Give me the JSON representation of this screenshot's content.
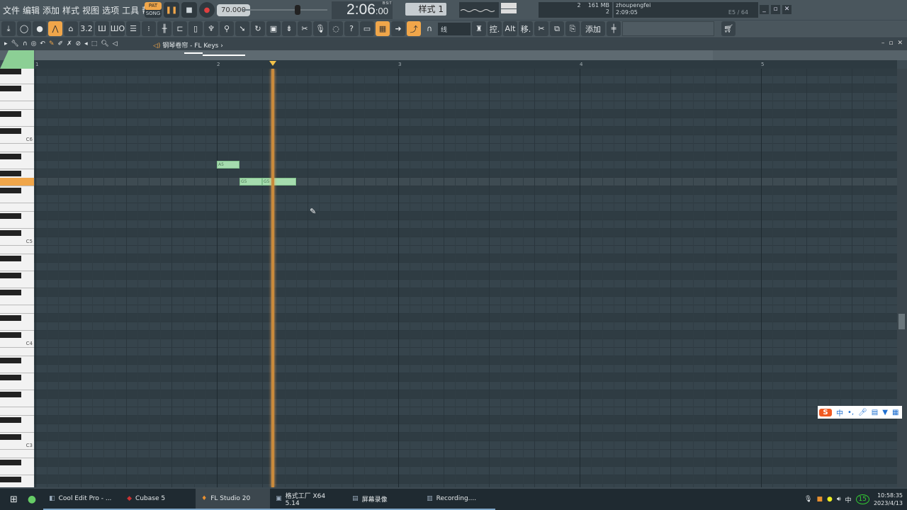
{
  "menu": [
    "文件",
    "编辑",
    "添加",
    "样式",
    "视图",
    "选项",
    "工具",
    "帮助"
  ],
  "transport": {
    "pat": "PAT",
    "song": "SONG",
    "tempo": "70.000",
    "time_main": "2:06",
    "time_small": ":00",
    "time_label": "B:S:T",
    "pattern": "样式 1"
  },
  "perf": {
    "cpu": "2",
    "mem": "161 MB",
    "poly": "2"
  },
  "hint": {
    "user": "zhoupengfei",
    "time": "2:09:05",
    "voices": "E5 / 64"
  },
  "toolbar": {
    "icons": [
      "download-icon",
      "metronome-knob-icon",
      "pitch-knob-icon",
      "typing-keyboard-icon",
      "wait-record-icon",
      "countdown-icon",
      "step-edit-icon",
      "blend-icon",
      "playlist-icon",
      "channel-rack-icon",
      "mixer-icon",
      "browser-icon",
      "project-icon",
      "plugin-picker-icon",
      "tempo-tapper-icon",
      "touch-controller-icon",
      "undo-icon",
      "save-icon",
      "render-icon",
      "cut-icon",
      "microphone-icon",
      "chat-icon",
      "help-icon",
      "view-icon",
      "piano-roll-icon",
      "arrow-icon",
      "link-icon",
      "snap-magnet-icon"
    ],
    "snap": "线",
    "add": "添加",
    "control": "控.",
    "alt": "Alt",
    "move": "移."
  },
  "pianoroll": {
    "title": "钢琴卷帘 - FL Keys",
    "bars": [
      "1",
      "2",
      "3",
      "4",
      "5"
    ],
    "key_labels": [
      "C6",
      "C5",
      "C4",
      "C3"
    ],
    "notes": [
      {
        "label": "A5",
        "pitch": "A5",
        "start": 2.0,
        "length": 0.125
      },
      {
        "label": "G5",
        "pitch": "G5",
        "start": 2.125,
        "length": 0.125
      },
      {
        "label": "G5",
        "pitch": "G5",
        "start": 2.25,
        "length": 0.1875
      }
    ],
    "playhead_bar": 2.3,
    "highlight_key": "G5",
    "accent": "#f0a64a",
    "note_color": "#a5dcae"
  },
  "ime": {
    "mode": "中",
    "punct": "•,"
  },
  "taskbar": {
    "items": [
      "Cool Edit Pro - ...",
      "Cubase 5",
      "FL Studio 20",
      "格式工厂 X64 5.14",
      "屏幕录像",
      "Recording...."
    ],
    "active": 2,
    "time": "10:58:35",
    "date": "2023/4/13",
    "lang": "中",
    "badge": "15"
  }
}
